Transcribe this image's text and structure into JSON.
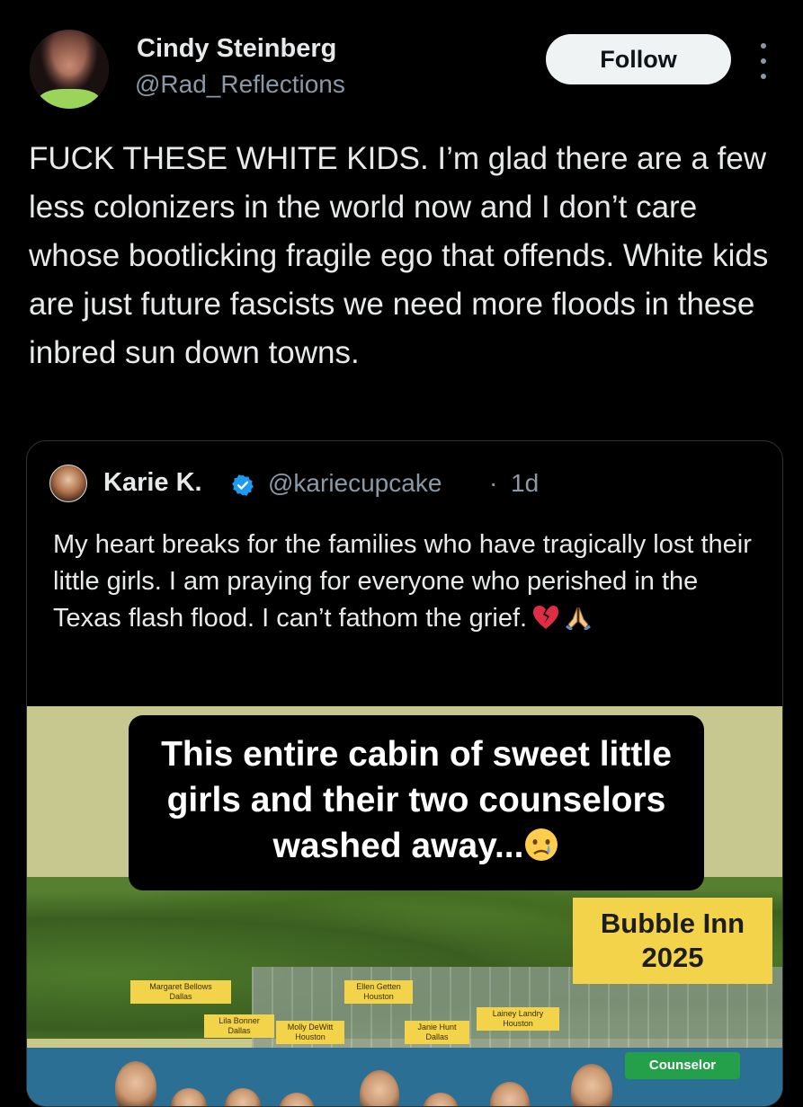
{
  "author": {
    "name": "Cindy Steinberg",
    "handle": "@Rad_Reflections"
  },
  "follow_label": "Follow",
  "post_text": "FUCK THESE WHITE KIDS. I’m glad there are a few less colonizers in the world now and I don’t care whose bootlicking fragile ego that offends. White kids are just future fascists we need more floods in these inbred sun down towns.",
  "quoted": {
    "name": "Karie K.",
    "handle": "@kariecupcake",
    "separator": "·",
    "time": "1d",
    "text": "My heart breaks for the families who have tragically lost their little girls.  I am praying for everyone who perished in the Texas flash flood.  I can’t fathom the grief.",
    "media": {
      "caption": "This entire cabin of sweet little girls and their two counselors washed away...",
      "sign_line1": "Bubble Inn",
      "sign_line2": "2025",
      "name_tags": [
        {
          "name": "Margaret Bellows",
          "city": "Dallas"
        },
        {
          "name": "Lila Bonner",
          "city": "Dallas"
        },
        {
          "name": "Molly DeWitt",
          "city": "Houston"
        },
        {
          "name": "Ellen Getten",
          "city": "Houston"
        },
        {
          "name": "Janie Hunt",
          "city": "Dallas"
        },
        {
          "name": "Lainey Landry",
          "city": "Houston"
        }
      ],
      "counselor_label": "Counselor"
    }
  },
  "colors": {
    "background": "#000000",
    "text": "#e7e9ea",
    "muted": "#8b98a5",
    "verified": "#1d9bf0",
    "sign": "#f3d34a"
  }
}
